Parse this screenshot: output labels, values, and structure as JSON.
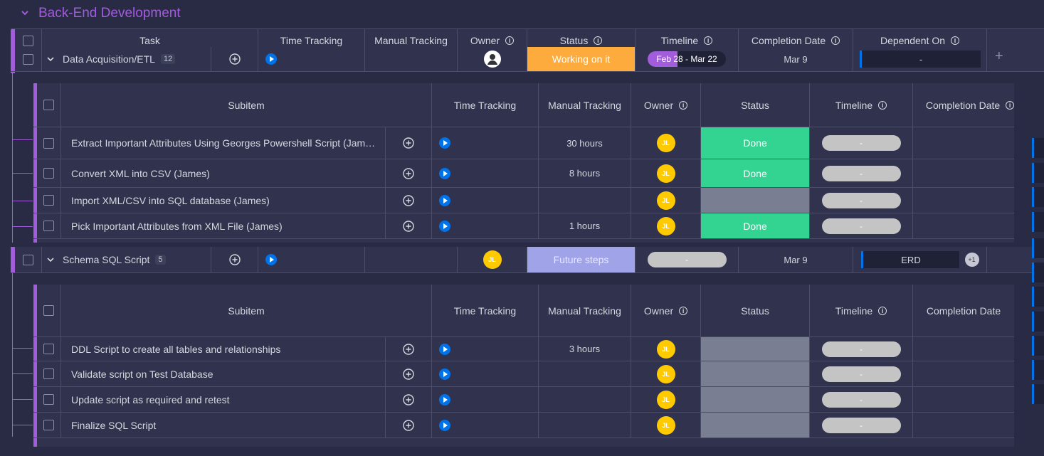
{
  "group": {
    "title": "Back-End Development",
    "color": "#a25ddc"
  },
  "main_columns": [
    "Task",
    "Time Tracking",
    "Manual Tracking",
    "Owner",
    "Status",
    "Timeline",
    "Completion Date",
    "Dependent On"
  ],
  "sub_columns": [
    "Subitem",
    "Time Tracking",
    "Manual Tracking",
    "Owner",
    "Status",
    "Timeline",
    "Completion Date"
  ],
  "items": [
    {
      "name": "Data Acquisition/ETL",
      "count": "12",
      "status": "Working on it",
      "status_color": "#fdab3d",
      "timeline": "Feb 28 - Mar 22",
      "completion": "Mar 9",
      "dependent": "-",
      "subitems": [
        {
          "name": "Extract Important Attributes Using Georges Powershell Script (Jam…",
          "manual": "30 hours",
          "owner": "JL",
          "status": "Done",
          "status_color": "#33d391",
          "timeline": "-"
        },
        {
          "name": "Convert XML into CSV (James)",
          "manual": "8 hours",
          "owner": "JL",
          "status": "Done",
          "status_color": "#33d391",
          "timeline": "-"
        },
        {
          "name": "Import XML/CSV into SQL database (James)",
          "manual": "",
          "owner": "JL",
          "status": "",
          "status_color": "#797e93",
          "timeline": "-"
        },
        {
          "name": "Pick Important Attributes from XML File (James)",
          "manual": "1 hours",
          "owner": "JL",
          "status": "Done",
          "status_color": "#33d391",
          "timeline": "-"
        }
      ]
    },
    {
      "name": "Schema SQL Script",
      "count": "5",
      "owner": "JL",
      "status": "Future steps",
      "status_color": "#a1a3e8",
      "timeline": "-",
      "completion": "Mar 9",
      "dependent": "ERD",
      "dependent_more": "+1",
      "subitems": [
        {
          "name": "DDL Script to create all tables and relationships",
          "manual": "3 hours",
          "owner": "JL",
          "status": "",
          "status_color": "#797e93",
          "timeline": "-"
        },
        {
          "name": "Validate script on Test Database",
          "manual": "",
          "owner": "JL",
          "status": "",
          "status_color": "#797e93",
          "timeline": "-"
        },
        {
          "name": "Update script as required and retest",
          "manual": "",
          "owner": "JL",
          "status": "",
          "status_color": "#797e93",
          "timeline": "-"
        },
        {
          "name": "Finalize SQL Script",
          "manual": "",
          "owner": "JL",
          "status": "",
          "status_color": "#797e93",
          "timeline": "-"
        }
      ]
    }
  ]
}
